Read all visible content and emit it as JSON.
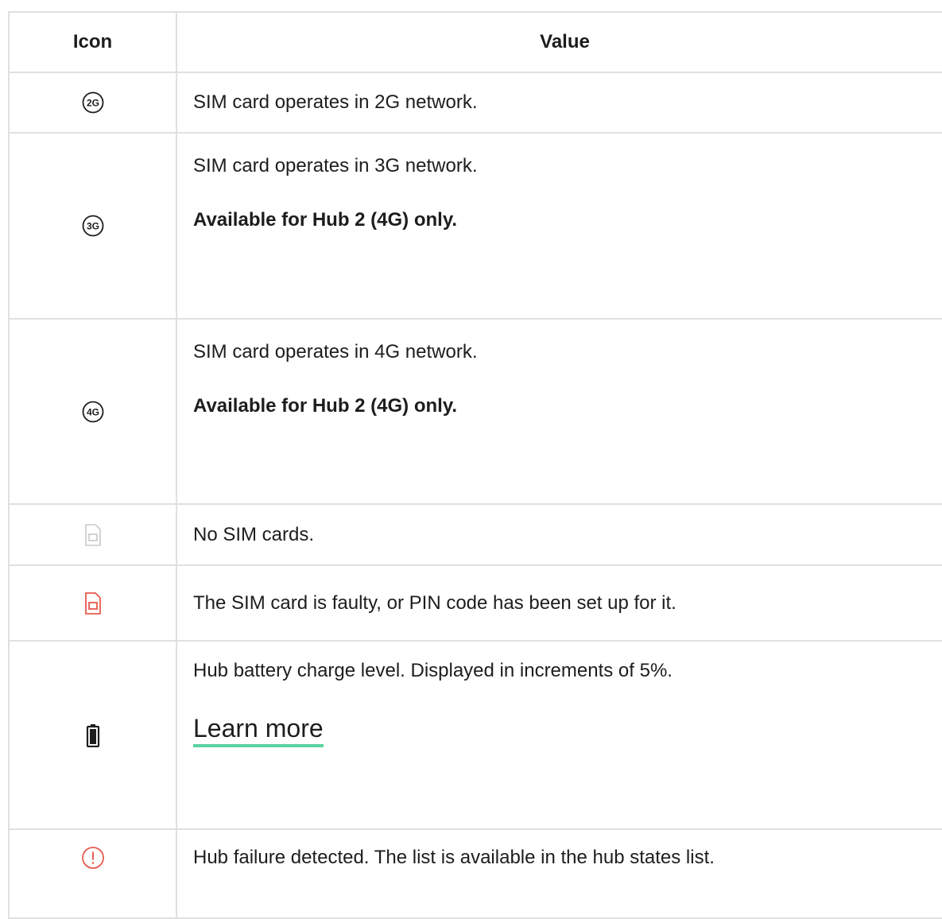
{
  "header": {
    "icon_col": "Icon",
    "value_col": "Value"
  },
  "rows": [
    {
      "icon": "2g-network-icon",
      "badge": "2G",
      "lines": [
        "SIM card operates in 2G network."
      ]
    },
    {
      "icon": "3g-network-icon",
      "badge": "3G",
      "lines": [
        "SIM card operates in 3G network."
      ],
      "note": "Available for Hub 2 (4G) only."
    },
    {
      "icon": "4g-network-icon",
      "badge": "4G",
      "lines": [
        "SIM card operates in 4G network."
      ],
      "note": "Available for Hub 2 (4G) only."
    },
    {
      "icon": "no-sim-icon",
      "lines": [
        "No SIM cards."
      ]
    },
    {
      "icon": "sim-error-icon",
      "lines": [
        "The SIM card is faulty, or PIN code has been set up for it."
      ]
    },
    {
      "icon": "battery-icon",
      "lines": [
        "Hub battery charge level. Displayed in increments of 5%."
      ],
      "link": "Learn more"
    },
    {
      "icon": "alert-icon",
      "lines": [
        "Hub failure detected. The list is available in the hub states list."
      ]
    }
  ],
  "colors": {
    "border": "#e0e0e0",
    "error": "#e85a4f",
    "muted": "#c8c8c8",
    "link_underline": "#5ad3a0"
  }
}
